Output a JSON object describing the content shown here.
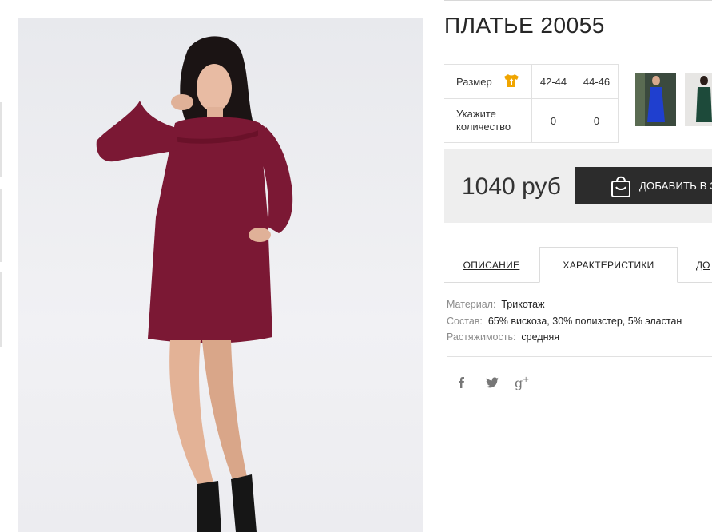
{
  "product": {
    "title": "ПЛАТЬЕ 20055",
    "price": "1040 руб",
    "dress_color": "#7b1834"
  },
  "size_table": {
    "size_label": "Размер",
    "quantity_label_line1": "Укажите",
    "quantity_label_line2": "количество",
    "sizes": [
      {
        "name": "42-44",
        "qty": "0"
      },
      {
        "name": "44-46",
        "qty": "0"
      }
    ],
    "size_chart_icon": "shirt-icon",
    "size_chart_icon_color": "#f0a500"
  },
  "cart": {
    "label": "ДОБАВИТЬ В З",
    "icon": "shopping-bag-icon"
  },
  "tabs": [
    {
      "label": "ОПИСАНИЕ",
      "active": false
    },
    {
      "label": "ХАРАКТЕРИСТИКИ",
      "active": true
    },
    {
      "label": "ДО",
      "active": false
    }
  ],
  "characteristics": [
    {
      "key": "Материал:",
      "value": "Трикотаж"
    },
    {
      "key": "Состав:",
      "value": "65% вискоза, 30% полизстер, 5% эластан"
    },
    {
      "key": "Растяжимость:",
      "value": "средняя"
    }
  ],
  "social": [
    {
      "icon": "facebook-icon",
      "glyph": "f"
    },
    {
      "icon": "twitter-icon",
      "glyph": "t"
    },
    {
      "icon": "google-plus-icon",
      "glyph": "g+"
    }
  ],
  "colors": {
    "button_bg": "#2c2c2c",
    "buy_box_bg": "#eeeeee",
    "thumb1_dress": "#1f3fcf",
    "thumb2_dress": "#1d4a3a"
  }
}
